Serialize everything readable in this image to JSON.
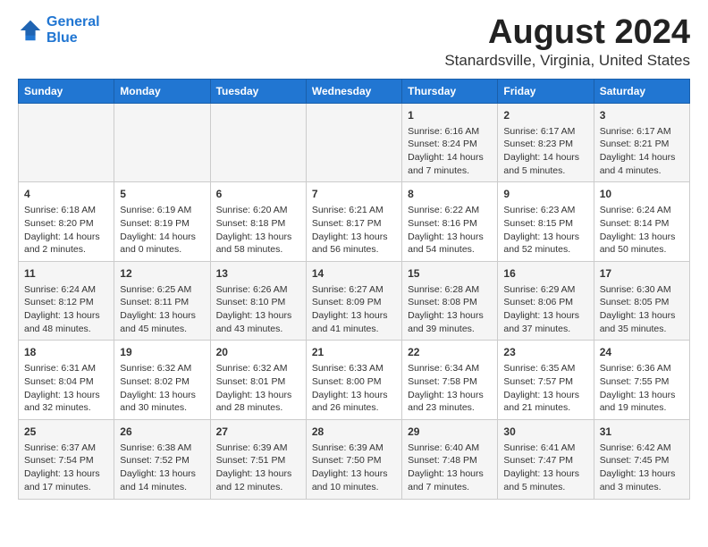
{
  "header": {
    "logo_line1": "General",
    "logo_line2": "Blue",
    "title": "August 2024",
    "subtitle": "Stanardsville, Virginia, United States"
  },
  "days_of_week": [
    "Sunday",
    "Monday",
    "Tuesday",
    "Wednesday",
    "Thursday",
    "Friday",
    "Saturday"
  ],
  "weeks": [
    [
      {
        "day": "",
        "content": ""
      },
      {
        "day": "",
        "content": ""
      },
      {
        "day": "",
        "content": ""
      },
      {
        "day": "",
        "content": ""
      },
      {
        "day": "1",
        "content": "Sunrise: 6:16 AM\nSunset: 8:24 PM\nDaylight: 14 hours and 7 minutes."
      },
      {
        "day": "2",
        "content": "Sunrise: 6:17 AM\nSunset: 8:23 PM\nDaylight: 14 hours and 5 minutes."
      },
      {
        "day": "3",
        "content": "Sunrise: 6:17 AM\nSunset: 8:21 PM\nDaylight: 14 hours and 4 minutes."
      }
    ],
    [
      {
        "day": "4",
        "content": "Sunrise: 6:18 AM\nSunset: 8:20 PM\nDaylight: 14 hours and 2 minutes."
      },
      {
        "day": "5",
        "content": "Sunrise: 6:19 AM\nSunset: 8:19 PM\nDaylight: 14 hours and 0 minutes."
      },
      {
        "day": "6",
        "content": "Sunrise: 6:20 AM\nSunset: 8:18 PM\nDaylight: 13 hours and 58 minutes."
      },
      {
        "day": "7",
        "content": "Sunrise: 6:21 AM\nSunset: 8:17 PM\nDaylight: 13 hours and 56 minutes."
      },
      {
        "day": "8",
        "content": "Sunrise: 6:22 AM\nSunset: 8:16 PM\nDaylight: 13 hours and 54 minutes."
      },
      {
        "day": "9",
        "content": "Sunrise: 6:23 AM\nSunset: 8:15 PM\nDaylight: 13 hours and 52 minutes."
      },
      {
        "day": "10",
        "content": "Sunrise: 6:24 AM\nSunset: 8:14 PM\nDaylight: 13 hours and 50 minutes."
      }
    ],
    [
      {
        "day": "11",
        "content": "Sunrise: 6:24 AM\nSunset: 8:12 PM\nDaylight: 13 hours and 48 minutes."
      },
      {
        "day": "12",
        "content": "Sunrise: 6:25 AM\nSunset: 8:11 PM\nDaylight: 13 hours and 45 minutes."
      },
      {
        "day": "13",
        "content": "Sunrise: 6:26 AM\nSunset: 8:10 PM\nDaylight: 13 hours and 43 minutes."
      },
      {
        "day": "14",
        "content": "Sunrise: 6:27 AM\nSunset: 8:09 PM\nDaylight: 13 hours and 41 minutes."
      },
      {
        "day": "15",
        "content": "Sunrise: 6:28 AM\nSunset: 8:08 PM\nDaylight: 13 hours and 39 minutes."
      },
      {
        "day": "16",
        "content": "Sunrise: 6:29 AM\nSunset: 8:06 PM\nDaylight: 13 hours and 37 minutes."
      },
      {
        "day": "17",
        "content": "Sunrise: 6:30 AM\nSunset: 8:05 PM\nDaylight: 13 hours and 35 minutes."
      }
    ],
    [
      {
        "day": "18",
        "content": "Sunrise: 6:31 AM\nSunset: 8:04 PM\nDaylight: 13 hours and 32 minutes."
      },
      {
        "day": "19",
        "content": "Sunrise: 6:32 AM\nSunset: 8:02 PM\nDaylight: 13 hours and 30 minutes."
      },
      {
        "day": "20",
        "content": "Sunrise: 6:32 AM\nSunset: 8:01 PM\nDaylight: 13 hours and 28 minutes."
      },
      {
        "day": "21",
        "content": "Sunrise: 6:33 AM\nSunset: 8:00 PM\nDaylight: 13 hours and 26 minutes."
      },
      {
        "day": "22",
        "content": "Sunrise: 6:34 AM\nSunset: 7:58 PM\nDaylight: 13 hours and 23 minutes."
      },
      {
        "day": "23",
        "content": "Sunrise: 6:35 AM\nSunset: 7:57 PM\nDaylight: 13 hours and 21 minutes."
      },
      {
        "day": "24",
        "content": "Sunrise: 6:36 AM\nSunset: 7:55 PM\nDaylight: 13 hours and 19 minutes."
      }
    ],
    [
      {
        "day": "25",
        "content": "Sunrise: 6:37 AM\nSunset: 7:54 PM\nDaylight: 13 hours and 17 minutes."
      },
      {
        "day": "26",
        "content": "Sunrise: 6:38 AM\nSunset: 7:52 PM\nDaylight: 13 hours and 14 minutes."
      },
      {
        "day": "27",
        "content": "Sunrise: 6:39 AM\nSunset: 7:51 PM\nDaylight: 13 hours and 12 minutes."
      },
      {
        "day": "28",
        "content": "Sunrise: 6:39 AM\nSunset: 7:50 PM\nDaylight: 13 hours and 10 minutes."
      },
      {
        "day": "29",
        "content": "Sunrise: 6:40 AM\nSunset: 7:48 PM\nDaylight: 13 hours and 7 minutes."
      },
      {
        "day": "30",
        "content": "Sunrise: 6:41 AM\nSunset: 7:47 PM\nDaylight: 13 hours and 5 minutes."
      },
      {
        "day": "31",
        "content": "Sunrise: 6:42 AM\nSunset: 7:45 PM\nDaylight: 13 hours and 3 minutes."
      }
    ]
  ]
}
